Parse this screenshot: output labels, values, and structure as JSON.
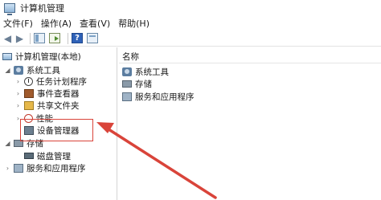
{
  "window": {
    "title": "计算机管理",
    "icon": "computer-management-icon"
  },
  "menubar": {
    "items": [
      "文件(F)",
      "操作(A)",
      "查看(V)",
      "帮助(H)"
    ]
  },
  "toolbar": {
    "buttons": [
      "back-arrow-icon",
      "forward-arrow-icon",
      "show-hide-pane-icon",
      "export-list-icon",
      "help-icon",
      "properties-icon"
    ],
    "help_glyph": "?"
  },
  "tree": {
    "root": "计算机管理(本地)",
    "system_tools": "系统工具",
    "task_scheduler": "任务计划程序",
    "event_viewer": "事件查看器",
    "shared_folders": "共享文件夹",
    "performance": "性能",
    "device_manager": "设备管理器",
    "storage": "存储",
    "disk_management": "磁盘管理",
    "services_apps": "服务和应用程序"
  },
  "content": {
    "column_header": "名称",
    "items": [
      "系统工具",
      "存储",
      "服务和应用程序"
    ]
  },
  "annotation": {
    "color": "#d9443a"
  }
}
